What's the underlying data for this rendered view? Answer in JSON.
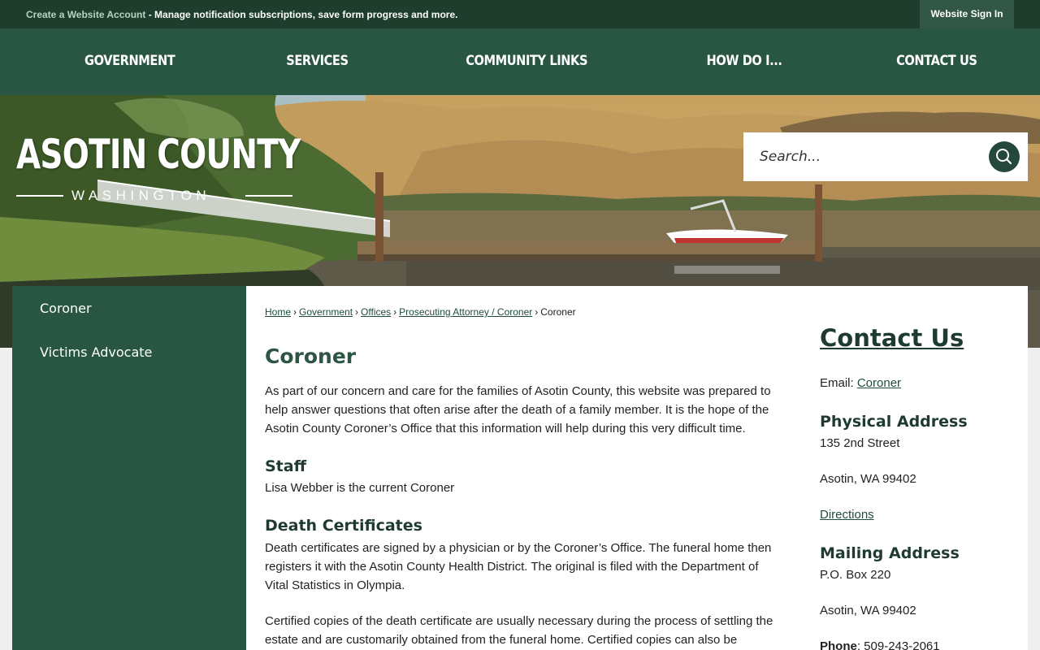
{
  "topbar": {
    "create_account_link": "Create a Website Account",
    "message": " - Manage notification subscriptions, save form progress and more.",
    "signin_label": "Website Sign In"
  },
  "nav": {
    "items": [
      {
        "label": "GOVERNMENT"
      },
      {
        "label": "SERVICES"
      },
      {
        "label": "COMMUNITY LINKS"
      },
      {
        "label": "HOW DO I..."
      },
      {
        "label": "CONTACT US"
      }
    ]
  },
  "logo": {
    "name": "ASOTIN COUNTY",
    "subtitle": "WASHINGTON"
  },
  "search": {
    "placeholder": "Search...",
    "icon": "search-icon"
  },
  "sidebar": {
    "items": [
      {
        "label": "Coroner"
      },
      {
        "label": "Victims Advocate"
      }
    ]
  },
  "breadcrumb": {
    "items": [
      "Home",
      "Government",
      "Offices",
      "Prosecuting Attorney / Coroner"
    ],
    "current": "Coroner",
    "separator": "›"
  },
  "page": {
    "title": "Coroner",
    "intro_lines": [
      "As part of our concern and care for the families of Asotin County, this website was prepared to",
      "help answer questions that often arise after the death of a family member. It is the hope of the",
      "Asotin County Coroner’s Office that this information will help during this very difficult time."
    ],
    "staff_heading": "Staff",
    "staff_text": "Lisa Webber is the current Coroner",
    "death_cert_heading": "Death Certificates",
    "death_cert_lines": [
      "Death certificates are signed by a physician or by the Coroner’s Office. The funeral home then",
      "registers it with the Asotin County Health District. The original is filed with the Department of",
      "Vital Statistics in Olympia."
    ],
    "certified_lines": [
      "Certified copies of the death certificate are usually necessary during the process of settling the",
      "estate and are customarily obtained from the funeral home. Certified copies can also be"
    ]
  },
  "contact": {
    "title": "Contact Us",
    "email_label": "Email: ",
    "email_link": "Coroner",
    "physical_heading": "Physical Address",
    "physical_street": "135 2nd Street",
    "physical_city": "Asotin, WA 99402",
    "directions_link": "Directions",
    "mailing_heading": "Mailing Address",
    "mailing_box": "P.O. Box 220",
    "mailing_city": "Asotin, WA 99402",
    "phone_label": "Phone",
    "phone_value": ": 509-243-2061"
  },
  "colors": {
    "topbar": "#1e3d2d",
    "nav": "#285643",
    "sidebar": "#285643",
    "heading": "#1f3b30",
    "link": "#1f4d3a"
  }
}
